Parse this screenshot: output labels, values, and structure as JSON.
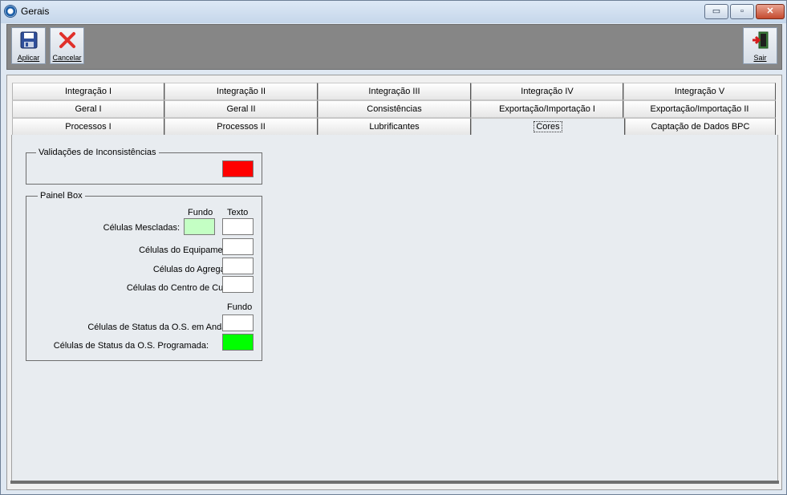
{
  "window": {
    "title": "Gerais",
    "min_glyph": "▭",
    "max_glyph": "▫",
    "close_glyph": "✕"
  },
  "toolbar": {
    "apply_label": "Aplicar",
    "cancel_label": "Cancelar",
    "exit_label": "Sair"
  },
  "tabs": {
    "row1": [
      "Integração I",
      "Integração II",
      "Integração III",
      "Integração IV",
      "Integração V"
    ],
    "row2": [
      "Geral I",
      "Geral II",
      "Consistências",
      "Exportação/Importação I",
      "Exportação/Importação II"
    ],
    "row3": [
      "Processos I",
      "Processos II",
      "Lubrificantes",
      "Cores",
      "Captação de Dados BPC"
    ],
    "active": "Cores"
  },
  "validacoes": {
    "title": "Validações de Inconsistências",
    "color": "#ff0000"
  },
  "painel": {
    "title": "Painel Box",
    "head_fundo": "Fundo",
    "head_texto": "Texto",
    "rows": [
      {
        "label": "Células Mescladas:",
        "fundo": "#c4ffc4",
        "texto": "#ffffff"
      },
      {
        "label": "Células do Equipamento:",
        "texto": "#ffffff"
      },
      {
        "label": "Células do Agregado:",
        "texto": "#ffffff"
      },
      {
        "label": "Células do Centro de Custo:",
        "texto": "#ffffff"
      }
    ],
    "head_fundo2": "Fundo",
    "status_rows": [
      {
        "label": "Células de Status da O.S. em Andamento:",
        "fundo": "#ffffff"
      },
      {
        "label": "Células de Status da O.S. Programada:",
        "fundo": "#00ff00"
      }
    ]
  }
}
